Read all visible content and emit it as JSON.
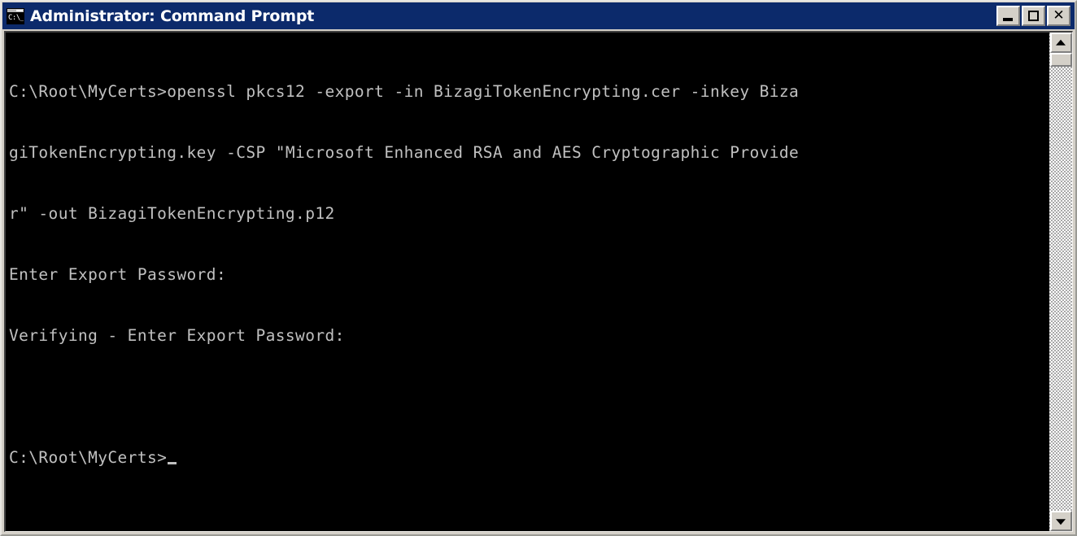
{
  "window": {
    "title": "Administrator: Command Prompt",
    "icon_name": "command-prompt-icon",
    "icon_text": "C:\\_",
    "titlebar_color": "#0c2a6b",
    "frame_color": "#d4d0c8",
    "buttons": {
      "minimize_label": "Minimize",
      "maximize_label": "Maximize",
      "close_label": "✕"
    }
  },
  "console": {
    "background_color": "#000000",
    "text_color": "#c0c0c0",
    "cursor": "_",
    "lines": [
      "C:\\Root\\MyCerts>openssl pkcs12 -export -in BizagiTokenEncrypting.cer -inkey Biza",
      "giTokenEncrypting.key -CSP \"Microsoft Enhanced RSA and AES Cryptographic Provide",
      "r\" -out BizagiTokenEncrypting.p12",
      "Enter Export Password:",
      "Verifying - Enter Export Password:",
      "",
      "C:\\Root\\MyCerts>"
    ],
    "prompt_line": "C:\\Root\\MyCerts>"
  },
  "scrollbar": {
    "up_arrow": "▲",
    "down_arrow": "▼",
    "thumb_position": "top"
  }
}
